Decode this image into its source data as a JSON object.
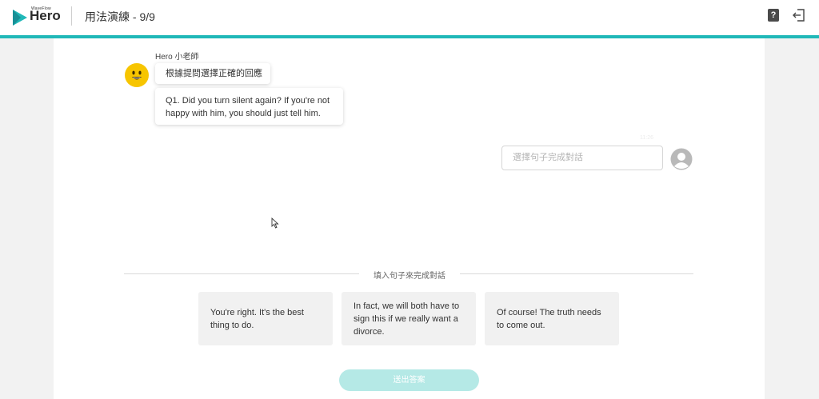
{
  "header": {
    "brand_small": "WaveFlow",
    "brand": "Hero",
    "title": "用法演練 - 9/9",
    "help_label": "?",
    "icons": {
      "logo": "play-triangle-logo-icon",
      "help": "question-mark-icon",
      "exit": "exit-icon"
    }
  },
  "colors": {
    "accent": "#20b8b8",
    "submit_disabled": "#b5e9e6",
    "avatar_yellow": "#f7c500"
  },
  "conversation": {
    "teacher_name": "Hero 小老師",
    "instruction": "根據提問選擇正確的回應",
    "question": "Q1. Did you turn silent again? If you're not happy with him, you should just tell him.",
    "answer_placeholder": "選擇句子完成對話",
    "answer_timestamp": "11:26"
  },
  "options_section": {
    "label": "填入句子來完成對話",
    "options": [
      {
        "text": "You're right. It's the best thing to do."
      },
      {
        "text": "In fact, we will both have to sign this if we really want a divorce."
      },
      {
        "text": "Of course! The truth needs to come out."
      }
    ]
  },
  "submit": {
    "label": "送出答案"
  }
}
